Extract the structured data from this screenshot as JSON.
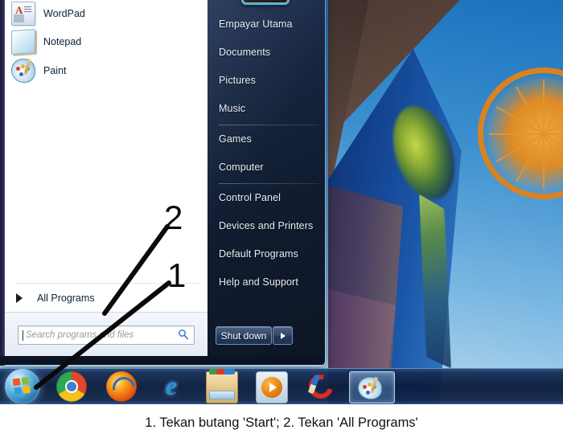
{
  "caption": {
    "text": "1. Tekan butang 'Start'; 2. Tekan 'All Programs'"
  },
  "annotations": {
    "marker_one": "1",
    "marker_two": "2"
  },
  "start_menu": {
    "left_panel": {
      "programs": [
        {
          "label": "WordPad",
          "icon": "wordpad-icon"
        },
        {
          "label": "Notepad",
          "icon": "notepad-icon"
        },
        {
          "label": "Paint",
          "icon": "paint-icon"
        }
      ],
      "all_programs": {
        "label": "All Programs",
        "icon": "chevron-right-icon"
      },
      "search": {
        "placeholder": "Search programs and files",
        "value": "",
        "icon": "search-icon"
      }
    },
    "right_panel": {
      "avatar": "user-avatar",
      "items": [
        {
          "label": "Empayar Utama"
        },
        {
          "label": "Documents"
        },
        {
          "label": "Pictures"
        },
        {
          "label": "Music"
        },
        {
          "label": "Games"
        },
        {
          "label": "Computer"
        },
        {
          "label": "Control Panel"
        },
        {
          "label": "Devices and Printers"
        },
        {
          "label": "Default Programs"
        },
        {
          "label": "Help and Support"
        }
      ],
      "shutdown": {
        "label": "Shut down",
        "arrow_icon": "triangle-right-icon"
      }
    }
  },
  "taskbar": {
    "start_button": "start-orb",
    "items": [
      {
        "name": "chrome",
        "label": "Google Chrome"
      },
      {
        "name": "firefox",
        "label": "Mozilla Firefox"
      },
      {
        "name": "internet-explorer",
        "label": "Internet Explorer",
        "glyph": "e"
      },
      {
        "name": "windows-explorer",
        "label": "Windows Explorer"
      },
      {
        "name": "windows-media-player",
        "label": "Windows Media Player"
      },
      {
        "name": "ccleaner",
        "label": "CCleaner"
      }
    ],
    "active_window": {
      "name": "paint",
      "label": "Paint"
    }
  },
  "colors": {
    "accent": "#2f8fd6",
    "menu_dark": "#101b2e",
    "panel_white": "#ffffff",
    "annotation": "#0a0a0a"
  }
}
